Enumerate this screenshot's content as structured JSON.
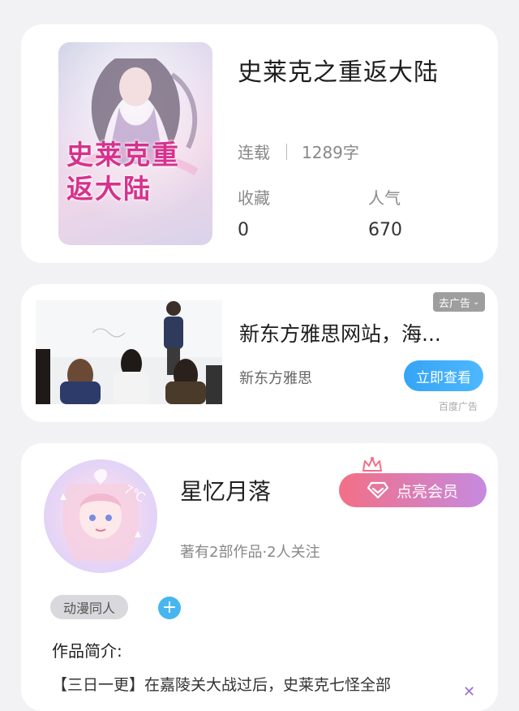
{
  "book": {
    "title": "史莱克之重返大陆",
    "cover_text": "史莱克重返大陆",
    "status": "连载",
    "word_count": "1289字",
    "favorites_label": "收藏",
    "favorites_value": "0",
    "popularity_label": "人气",
    "popularity_value": "670"
  },
  "ad": {
    "close_label": "去广告",
    "close_icon": "chevron-down-icon",
    "title": "新东方雅思网站，海...",
    "brand": "新东方雅思",
    "cta_label": "立即查看",
    "source_tag": "百度广告",
    "accent": "#35a4f5"
  },
  "author": {
    "name": "星忆月落",
    "vip_label": "点亮会员",
    "vip_icon": "diamond-icon",
    "crown_icon": "crown-icon",
    "meta": "著有2部作品·2人关注",
    "tag": "动漫同人",
    "add_tag_icon": "plus-icon",
    "intro_heading": "作品简介:",
    "intro_text": "【三日一更】在嘉陵关大战过后，史莱克七怪全部",
    "expand_icon": "chevron-down-icon",
    "vip_gradient": [
      "#f26f86",
      "#c68ae0"
    ]
  }
}
